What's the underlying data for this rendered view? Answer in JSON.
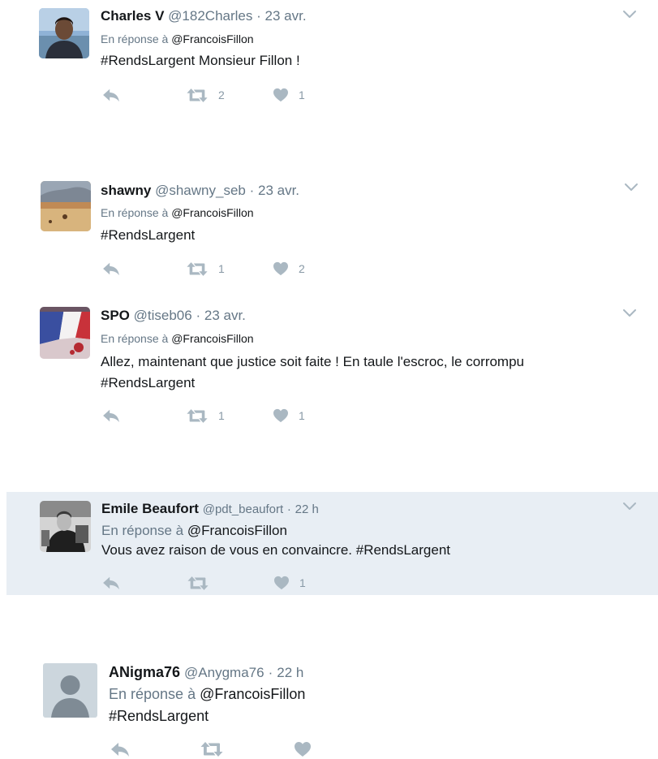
{
  "colors": {
    "highlight_bg": "#e8eef4",
    "icon": "#aab8c2",
    "muted_text": "#657786"
  },
  "tweets": [
    {
      "avatar": "selfie-portrait-avatar",
      "name": "Charles V",
      "handle": "@182Charles",
      "dot": "·",
      "time": "23 avr.",
      "reply_prefix": "En réponse à",
      "reply_to": "@FrancoisFillon",
      "lines": [
        "#RendsLargent Monsieur Fillon !"
      ],
      "retweets": "2",
      "likes": "1"
    },
    {
      "avatar": "beach-landscape-avatar",
      "name": "shawny",
      "handle": "@shawny_seb",
      "dot": "·",
      "time": "23 avr.",
      "reply_prefix": "En réponse à",
      "reply_to": "@FrancoisFillon",
      "lines": [
        "#RendsLargent"
      ],
      "retweets": "1",
      "likes": "2"
    },
    {
      "avatar": "french-flag-avatar",
      "name": "SPO",
      "handle": "@tiseb06",
      "dot": "·",
      "time": "23 avr.",
      "reply_prefix": "En réponse à",
      "reply_to": "@FrancoisFillon",
      "lines": [
        "Allez, maintenant que justice soit faite ! En taule l'escroc, le corrompu",
        "#RendsLargent"
      ],
      "retweets": "1",
      "likes": "1"
    },
    {
      "avatar": "black-white-photo-avatar",
      "name": "Emile Beaufort",
      "handle": "@pdt_beaufort",
      "dot": "·",
      "time": "22 h",
      "reply_prefix": "En réponse à",
      "reply_to": "@FrancoisFillon",
      "lines": [
        "Vous avez raison de vous en convaincre. #RendsLargent"
      ],
      "retweets": "",
      "likes": "1"
    },
    {
      "avatar": "default-user-avatar",
      "name": "ANigma76",
      "handle": "@Anygma76",
      "dot": "·",
      "time": "22 h",
      "reply_prefix": "En réponse à",
      "reply_to": "@FrancoisFillon",
      "lines": [
        "#RendsLargent"
      ],
      "retweets": "",
      "likes": ""
    }
  ]
}
